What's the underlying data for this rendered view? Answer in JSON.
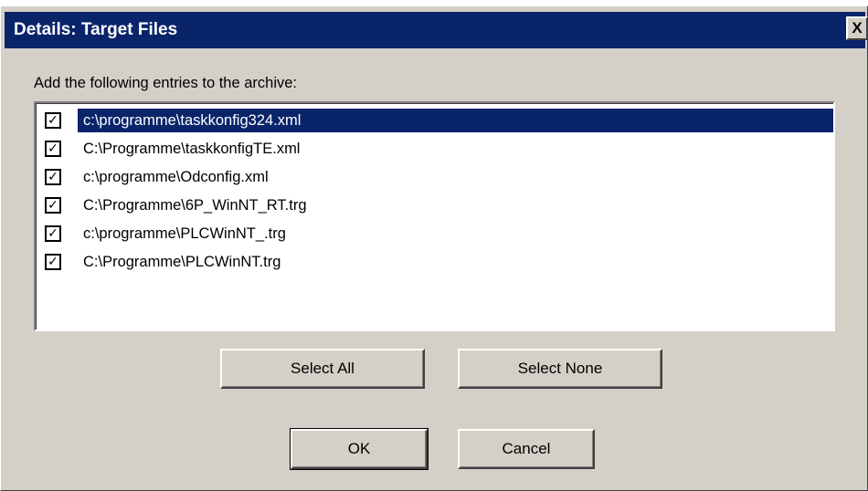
{
  "dialog": {
    "title": "Details: Target Files",
    "close_glyph": "X",
    "close_icon": "close-icon",
    "instruction": "Add the following entries to the archive:"
  },
  "entries": [
    {
      "path": "c:\\programme\\taskkonfig324.xml",
      "checked": true,
      "selected": true
    },
    {
      "path": "C:\\Programme\\taskkonfigTE.xml",
      "checked": true,
      "selected": false
    },
    {
      "path": "c:\\programme\\Odconfig.xml",
      "checked": true,
      "selected": false
    },
    {
      "path": "C:\\Programme\\6P_WinNT_RT.trg",
      "checked": true,
      "selected": false
    },
    {
      "path": "c:\\programme\\PLCWinNT_.trg",
      "checked": true,
      "selected": false
    },
    {
      "path": "C:\\Programme\\PLCWinNT.trg",
      "checked": true,
      "selected": false
    }
  ],
  "check_glyph": "✓",
  "buttons": {
    "select_all": "Select All",
    "select_none": "Select None",
    "ok": "OK",
    "cancel": "Cancel"
  },
  "colors": {
    "title_bar": "#0a246a",
    "selection": "#0a246a",
    "face": "#d4d0c8"
  }
}
